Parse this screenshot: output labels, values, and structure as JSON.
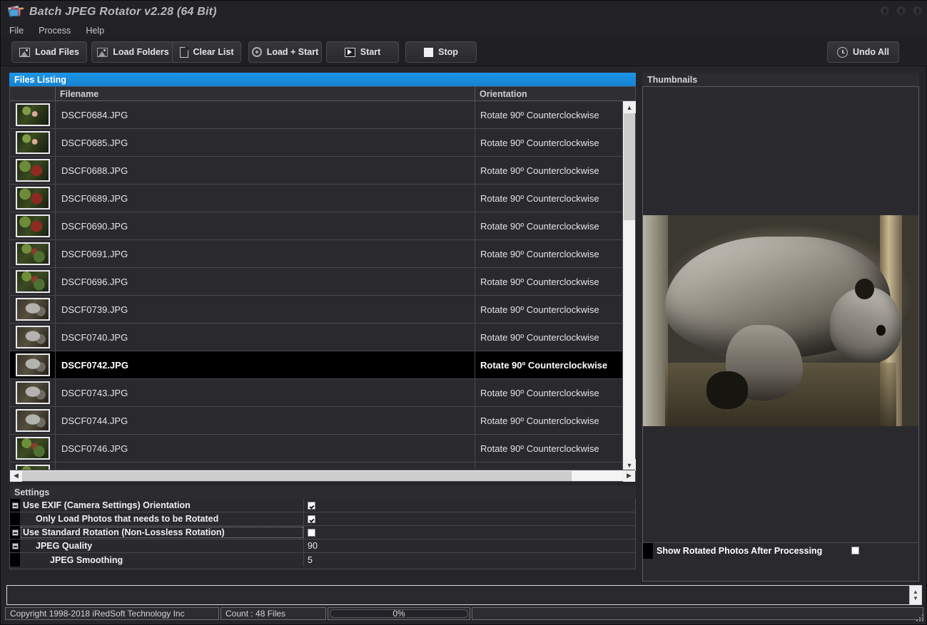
{
  "window": {
    "title": "Batch JPEG Rotator v2.28 (64 Bit)",
    "icon": "app-photos-icon",
    "controls": [
      "minimize",
      "maximize",
      "close"
    ]
  },
  "menu": {
    "items": [
      {
        "label": "File"
      },
      {
        "label": "Process"
      },
      {
        "label": "Help"
      }
    ]
  },
  "toolbar": {
    "buttons": [
      {
        "label": "Load Files",
        "icon": "photo-icon"
      },
      {
        "label": "Load Folders",
        "icon": "folder-photo-icon"
      },
      {
        "label": "Clear List",
        "icon": "document-icon"
      },
      {
        "label": "Load + Start",
        "icon": "gear-icon"
      },
      {
        "label": "Start",
        "icon": "play-icon"
      },
      {
        "label": "Stop",
        "icon": "stop-icon"
      }
    ],
    "undo_all": {
      "label": "Undo All",
      "icon": "undo-clock-icon"
    }
  },
  "files_panel": {
    "title": "Files Listing",
    "columns": {
      "thumbnail": "",
      "filename": "Filename",
      "orientation": "Orientation"
    },
    "rows": [
      {
        "filename": "DSCF0684.JPG",
        "orientation": "Rotate 90º Counterclockwise",
        "thumb": "bird",
        "selected": false
      },
      {
        "filename": "DSCF0685.JPG",
        "orientation": "Rotate 90º Counterclockwise",
        "thumb": "bird",
        "selected": false
      },
      {
        "filename": "DSCF0688.JPG",
        "orientation": "Rotate 90º Counterclockwise",
        "thumb": "red",
        "selected": false
      },
      {
        "filename": "DSCF0689.JPG",
        "orientation": "Rotate 90º Counterclockwise",
        "thumb": "red",
        "selected": false
      },
      {
        "filename": "DSCF0690.JPG",
        "orientation": "Rotate 90º Counterclockwise",
        "thumb": "red",
        "selected": false
      },
      {
        "filename": "DSCF0691.JPG",
        "orientation": "Rotate 90º Counterclockwise",
        "thumb": "leaf",
        "selected": false
      },
      {
        "filename": "DSCF0696.JPG",
        "orientation": "Rotate 90º Counterclockwise",
        "thumb": "leaf",
        "selected": false
      },
      {
        "filename": "DSCF0739.JPG",
        "orientation": "Rotate 90º Counterclockwise",
        "thumb": "ape",
        "selected": false
      },
      {
        "filename": "DSCF0740.JPG",
        "orientation": "Rotate 90º Counterclockwise",
        "thumb": "ape",
        "selected": false
      },
      {
        "filename": "DSCF0742.JPG",
        "orientation": "Rotate 90º Counterclockwise",
        "thumb": "ape",
        "selected": true
      },
      {
        "filename": "DSCF0743.JPG",
        "orientation": "Rotate 90º Counterclockwise",
        "thumb": "ape",
        "selected": false
      },
      {
        "filename": "DSCF0744.JPG",
        "orientation": "Rotate 90º Counterclockwise",
        "thumb": "ape",
        "selected": false
      },
      {
        "filename": "DSCF0746.JPG",
        "orientation": "Rotate 90º Counterclockwise",
        "thumb": "leaf",
        "selected": false
      },
      {
        "filename": "",
        "orientation": "",
        "thumb": "leaf",
        "selected": false
      }
    ]
  },
  "settings_panel": {
    "title": "Settings",
    "rows": [
      {
        "label": "Use EXIF (Camera Settings) Orientation",
        "value": "",
        "control": "checkbox",
        "checked": true,
        "indent": 0,
        "collapsible": true,
        "focused": false
      },
      {
        "label": "Only Load Photos that needs to be Rotated",
        "value": "",
        "control": "checkbox",
        "checked": true,
        "indent": 1,
        "collapsible": false,
        "focused": false
      },
      {
        "label": "Use Standard Rotation (Non-Lossless Rotation)",
        "value": "",
        "control": "checkbox",
        "checked": false,
        "indent": 0,
        "collapsible": true,
        "focused": true
      },
      {
        "label": "JPEG Quality",
        "value": "90",
        "control": "text",
        "checked": false,
        "indent": 1,
        "collapsible": true,
        "focused": false
      },
      {
        "label": "JPEG Smoothing",
        "value": "5",
        "control": "text",
        "checked": false,
        "indent": 2,
        "collapsible": false,
        "focused": false
      }
    ]
  },
  "thumbnails_panel": {
    "title": "Thumbnails",
    "preview_alt": "rotated photo of an ape resting on a beam",
    "show_rotated": {
      "label": "Show Rotated Photos After Processing",
      "checked": false
    }
  },
  "log": {
    "text": ""
  },
  "statusbar": {
    "copyright": "Copyright 1998-2018 iRedSoft Technology Inc",
    "count": "Count : 48 Files",
    "progress_text": "0%",
    "progress_value": 0
  },
  "colors": {
    "accent_blue": "#1a8fe0",
    "window_bg": "#26262a",
    "panel_bg": "#2a2a2e",
    "text": "#e4e4e8",
    "selected_row_bg": "#000000"
  }
}
